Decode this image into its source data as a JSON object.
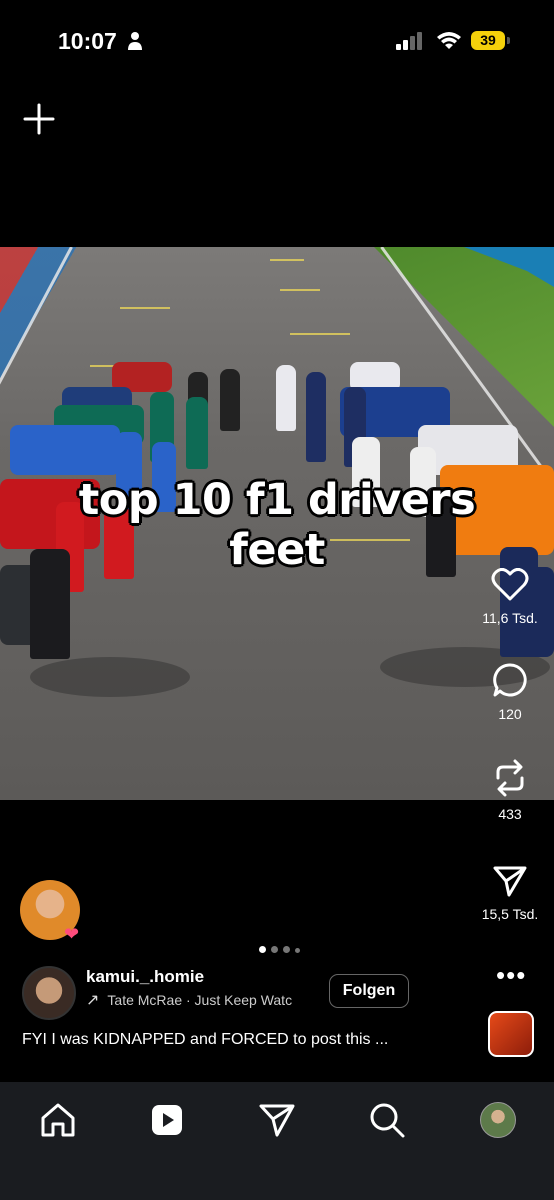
{
  "status_bar": {
    "time": "10:07",
    "battery": "39"
  },
  "video": {
    "caption_line1": "top 10 f1 drivers",
    "caption_line2": "feet"
  },
  "actions": {
    "likes": "11,6 Tsd.",
    "comments": "120",
    "remixes": "433",
    "shares": "15,5 Tsd."
  },
  "post": {
    "username": "kamui._.homie",
    "audio": "Tate McRae · Just Keep Watc",
    "follow_label": "Folgen",
    "caption": "FYI I was KIDNAPPED and FORCED to post this ..."
  },
  "carousel": {
    "count": 4,
    "active": 0
  },
  "nav": [
    "home-icon",
    "reels-icon",
    "send-icon",
    "search-icon",
    "profile-avatar"
  ]
}
